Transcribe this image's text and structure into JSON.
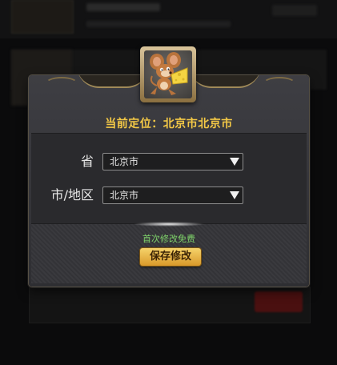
{
  "location": {
    "text": "当前定位：北京市北京市"
  },
  "form": {
    "province": {
      "label": "省",
      "value": "北京市"
    },
    "city": {
      "label": "市/地区",
      "value": "北京市"
    }
  },
  "footer": {
    "note": "首次修改免费",
    "save_label": "保存修改"
  },
  "avatar": {
    "icon": "mouse-with-cheese-icon"
  }
}
